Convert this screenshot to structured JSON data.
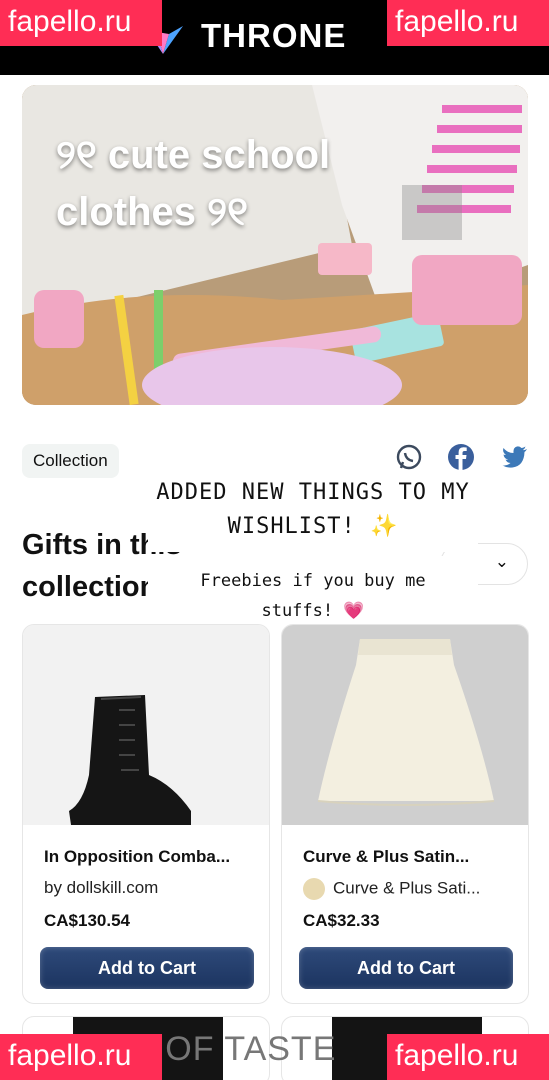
{
  "app": {
    "logo_text": "THRONE"
  },
  "watermark": {
    "text": "fapello.ru",
    "color": "#ff2d55"
  },
  "hero": {
    "title": "୨୧ cute school clothes ୨୧"
  },
  "collection": {
    "badge": "Collection",
    "share_icons": [
      "whatsapp-icon",
      "facebook-icon",
      "twitter-icon"
    ]
  },
  "gifts": {
    "title": "Gifts in this collection",
    "sort_icon": "chevron-down-icon"
  },
  "story_overlay": {
    "line1": "ADDED NEW THINGS TO MY",
    "line2": "WISHLIST! ✨",
    "line3": "Freebies if you buy me",
    "line4": "stuffs! 💗"
  },
  "products": [
    {
      "name": "In Opposition Comba...",
      "seller": "by dollskill.com",
      "price": "CA$130.54",
      "button": "Add to Cart"
    },
    {
      "name": "Curve & Plus Satin...",
      "seller": "Curve & Plus Sati...",
      "price": "CA$32.33",
      "button": "Add to Cart"
    }
  ],
  "bottom_partial_text": "TY OF TASTE",
  "colors": {
    "accent": "#1f3763",
    "chip_bg": "#f1f4f3",
    "whatsapp": "#3c4a5e",
    "facebook": "#3a5f9c",
    "twitter": "#3d79b8"
  }
}
